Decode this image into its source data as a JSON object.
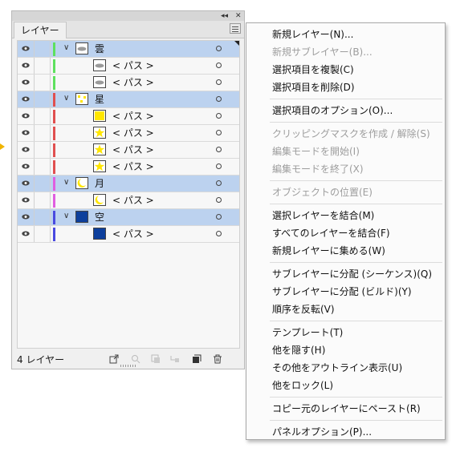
{
  "panel": {
    "title_icons": [
      "collapse-icon",
      "close-icon"
    ],
    "tab_label": "レイヤー",
    "footer_count": "4 レイヤー"
  },
  "colors": {
    "green": "#5ee05e",
    "red": "#e05050",
    "magenta": "#e05ee0",
    "blue": "#4a4ae0",
    "selected_row": "#bcd2ef",
    "star_yellow": "#ffe600",
    "navy": "#0d3f9c"
  },
  "rows": [
    {
      "type": "layer",
      "label": "雲",
      "color": "green",
      "thumb": "cloud"
    },
    {
      "type": "item",
      "label": "< パス >",
      "color": "green",
      "thumb": "cloud"
    },
    {
      "type": "item",
      "label": "< パス >",
      "color": "green",
      "thumb": "cloud"
    },
    {
      "type": "layer",
      "label": "星",
      "color": "red",
      "thumb": "stars"
    },
    {
      "type": "item",
      "label": "< パス >",
      "color": "red",
      "thumb": "square-yellow"
    },
    {
      "type": "item",
      "label": "< パス >",
      "color": "red",
      "thumb": "star"
    },
    {
      "type": "item",
      "label": "< パス >",
      "color": "red",
      "thumb": "star"
    },
    {
      "type": "item",
      "label": "< パス >",
      "color": "red",
      "thumb": "star"
    },
    {
      "type": "layer",
      "label": "月",
      "color": "magenta",
      "thumb": "moon"
    },
    {
      "type": "item",
      "label": "< パス >",
      "color": "magenta",
      "thumb": "moon"
    },
    {
      "type": "layer",
      "label": "空",
      "color": "blue",
      "thumb": "navy"
    },
    {
      "type": "item",
      "label": "< パス >",
      "color": "blue",
      "thumb": "navy"
    }
  ],
  "menu": {
    "items": [
      {
        "label": "新規レイヤー(N)...",
        "enabled": true
      },
      {
        "label": "新規サブレイヤー(B)...",
        "enabled": false
      },
      {
        "label": "選択項目を複製(C)",
        "enabled": true
      },
      {
        "label": "選択項目を削除(D)",
        "enabled": true
      },
      {
        "label": "選択項目のオプション(O)...",
        "enabled": true
      },
      {
        "label": "クリッピングマスクを作成 / 解除(S)",
        "enabled": false
      },
      {
        "label": "編集モードを開始(I)",
        "enabled": false
      },
      {
        "label": "編集モードを終了(X)",
        "enabled": false
      },
      {
        "label": "オブジェクトの位置(E)",
        "enabled": false
      },
      {
        "label": "選択レイヤーを結合(M)",
        "enabled": true
      },
      {
        "label": "すべてのレイヤーを結合(F)",
        "enabled": true
      },
      {
        "label": "新規レイヤーに集める(W)",
        "enabled": true
      },
      {
        "label": "サブレイヤーに分配 (シーケンス)(Q)",
        "enabled": true
      },
      {
        "label": "サブレイヤーに分配 (ビルド)(Y)",
        "enabled": true
      },
      {
        "label": "順序を反転(V)",
        "enabled": true
      },
      {
        "label": "テンプレート(T)",
        "enabled": true
      },
      {
        "label": "他を隠す(H)",
        "enabled": true
      },
      {
        "label": "その他をアウトライン表示(U)",
        "enabled": true
      },
      {
        "label": "他をロック(L)",
        "enabled": true
      },
      {
        "label": "コピー元のレイヤーにペースト(R)",
        "enabled": true
      },
      {
        "label": "パネルオプション(P)...",
        "enabled": true
      }
    ]
  }
}
